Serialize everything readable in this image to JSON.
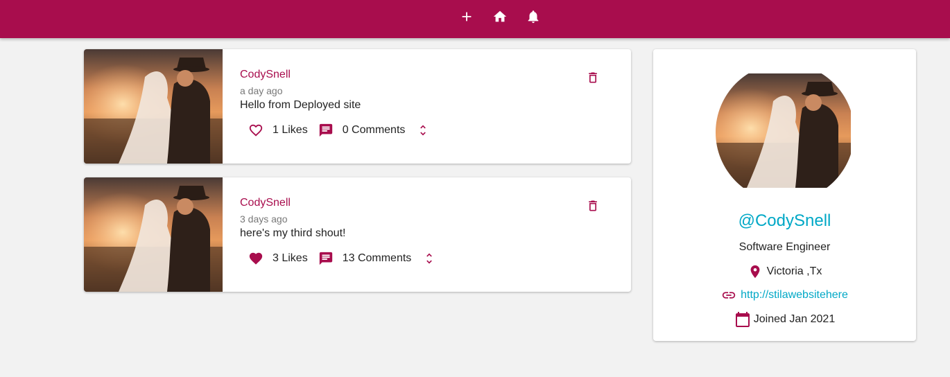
{
  "nav": {
    "items": [
      {
        "name": "add",
        "icon": "plus-icon"
      },
      {
        "name": "home",
        "icon": "home-icon"
      },
      {
        "name": "notifications",
        "icon": "bell-icon"
      }
    ],
    "color": "#a80d4d"
  },
  "posts": [
    {
      "user": "CodySnell",
      "time": "a day ago",
      "body": "Hello from Deployed site",
      "likes": "1 Likes",
      "liked": false,
      "comments": "0 Comments"
    },
    {
      "user": "CodySnell",
      "time": "3 days ago",
      "body": "here's my third shout!",
      "likes": "3 Likes",
      "liked": true,
      "comments": "13 Comments"
    }
  ],
  "profile": {
    "handle": "@CodySnell",
    "bio": "Software Engineer",
    "location": "Victoria ,Tx",
    "website": "http://stilawebsitehere",
    "joined": "Joined Jan 2021"
  },
  "colors": {
    "accent": "#a80d4d",
    "link": "#00a8c6",
    "background": "#f2f2f2"
  }
}
